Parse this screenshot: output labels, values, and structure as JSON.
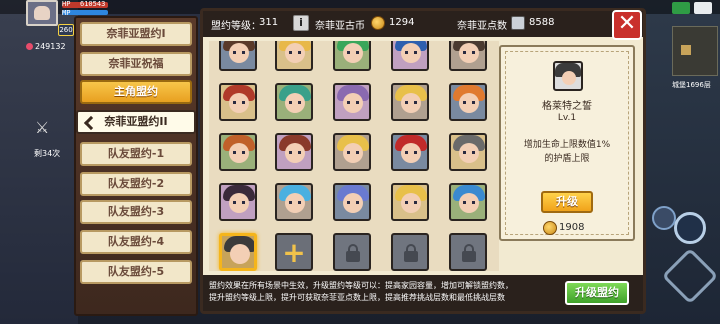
{
  "hud": {
    "hp_label": "HP",
    "mp_label": "MP",
    "hp_value": "610543",
    "level": "260",
    "gems": "249132",
    "count": "剩34次",
    "map_label": "城堡1696层"
  },
  "header": {
    "pact_level_label": "盟约等级：",
    "pact_level_value": "311",
    "coin_label": "奈菲亚古币",
    "coin_value": "1294",
    "points_label": "奈菲亚点数",
    "points_value": "8588"
  },
  "tabs": [
    {
      "label": "奈菲亚盟约I",
      "state": "normal"
    },
    {
      "label": "奈菲亚祝福",
      "state": "normal"
    },
    {
      "label": "主角盟约",
      "state": "gold"
    },
    {
      "label": "奈菲亚盟约II",
      "state": "selected"
    },
    {
      "label": "队友盟约-1",
      "state": "normal"
    },
    {
      "label": "队友盟约-2",
      "state": "normal"
    },
    {
      "label": "队友盟约-3",
      "state": "normal"
    },
    {
      "label": "队友盟约-4",
      "state": "normal"
    },
    {
      "label": "队友盟约-5",
      "state": "normal"
    }
  ],
  "grid": {
    "rows": [
      [
        "#5a3a2a",
        "#e8b84a",
        "#3aa65a",
        "#2e5fae",
        "#4a3a30"
      ],
      [
        "#b03a2a",
        "#3aa08a",
        "#8a6ab0",
        "#e8c04a",
        "#e07a30"
      ],
      [
        "#c0602a",
        "#8a3a2a",
        "#e8c04a",
        "#c02a2a",
        "#6a6a6a"
      ],
      [
        "#3a2a3a",
        "#4ab0e0",
        "#6a7ad0",
        "#e8c04a",
        "#3a8ad0"
      ]
    ],
    "last_row": [
      {
        "type": "character",
        "hair": "#3b3b3b",
        "selected": true
      },
      {
        "type": "plus"
      },
      {
        "type": "lock"
      },
      {
        "type": "lock"
      },
      {
        "type": "lock"
      }
    ]
  },
  "card": {
    "name": "格莱特之誓",
    "level": "Lv.1",
    "desc_line1": "增加生命上限数值1%",
    "desc_line2": "的护盾上限",
    "upgrade_label": "升级",
    "cost": "1908"
  },
  "footer": {
    "line1": "盟约效果在所有场景中生效，升级盟约等级可以：提高家园容量，增加可解锁盟约数，",
    "line2": "提升盟约等级上限，提升可获取奈菲亚点数上限，提高推荐挑战层数和最低挑战层数",
    "button_label": "升级盟约"
  },
  "colors": {
    "accent_gold": "#f0a21a",
    "accent_green": "#3fa12a",
    "close_red": "#c9302c"
  }
}
